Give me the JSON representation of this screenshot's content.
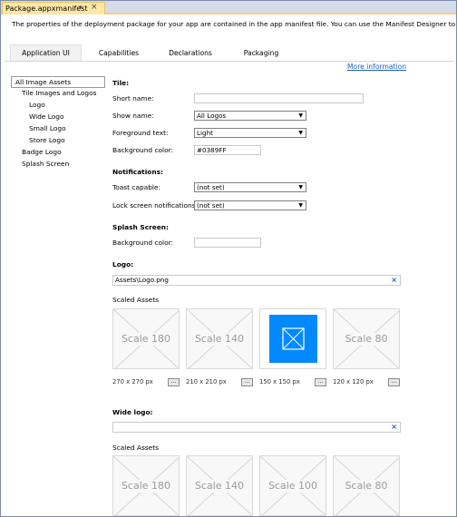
{
  "document_tab": {
    "title": "Package.appxmanifest"
  },
  "description": "The properties of the deployment package for your app are contained in the app manifest file. You can use the Manifest Designer to set or modify one",
  "tabs": [
    {
      "label": "Application UI",
      "active": true
    },
    {
      "label": "Capabilities",
      "active": false
    },
    {
      "label": "Declarations",
      "active": false
    },
    {
      "label": "Packaging",
      "active": false
    }
  ],
  "more_information": "More information",
  "tree": [
    {
      "label": "All Image Assets",
      "level": 0,
      "selected": true
    },
    {
      "label": "Tile Images and Logos",
      "level": 1,
      "selected": false
    },
    {
      "label": "Logo",
      "level": 2,
      "selected": false
    },
    {
      "label": "Wide Logo",
      "level": 2,
      "selected": false
    },
    {
      "label": "Small Logo",
      "level": 2,
      "selected": false
    },
    {
      "label": "Store Logo",
      "level": 2,
      "selected": false
    },
    {
      "label": "Badge Logo",
      "level": 1,
      "selected": false
    },
    {
      "label": "Splash Screen",
      "level": 1,
      "selected": false
    }
  ],
  "tile": {
    "heading": "Tile:",
    "short_name_label": "Short name:",
    "short_name_value": "",
    "show_name_label": "Show name:",
    "show_name_value": "All Logos",
    "foreground_label": "Foreground text:",
    "foreground_value": "Light",
    "background_label": "Background color:",
    "background_value": "#0389FF"
  },
  "notifications": {
    "heading": "Notifications:",
    "toast_label": "Toast capable:",
    "toast_value": "(not set)",
    "lock_label": "Lock screen notifications:",
    "lock_value": "(not set)"
  },
  "splash": {
    "heading": "Splash Screen:",
    "background_label": "Background color:",
    "background_value": ""
  },
  "logo": {
    "heading": "Logo:",
    "path": "Assets\\Logo.png",
    "scaled_heading": "Scaled Assets",
    "assets": [
      {
        "label": "Scale 180",
        "size": "270 x 270 px",
        "filled": false
      },
      {
        "label": "Scale 140",
        "size": "210 x 210 px",
        "filled": false
      },
      {
        "label": "",
        "size": "150 x 150 px",
        "filled": true
      },
      {
        "label": "Scale 80",
        "size": "120 x 120 px",
        "filled": false
      }
    ]
  },
  "wide_logo": {
    "heading": "Wide logo:",
    "path": "",
    "scaled_heading": "Scaled Assets",
    "assets": [
      {
        "label": "Scale 180"
      },
      {
        "label": "Scale 140"
      },
      {
        "label": "Scale 100"
      },
      {
        "label": "Scale 80"
      }
    ]
  },
  "browse_label": "...",
  "colors": {
    "accent_blue": "#0389ff",
    "link": "#1a5fbf",
    "tab_highlight": "#ffe8a6"
  }
}
